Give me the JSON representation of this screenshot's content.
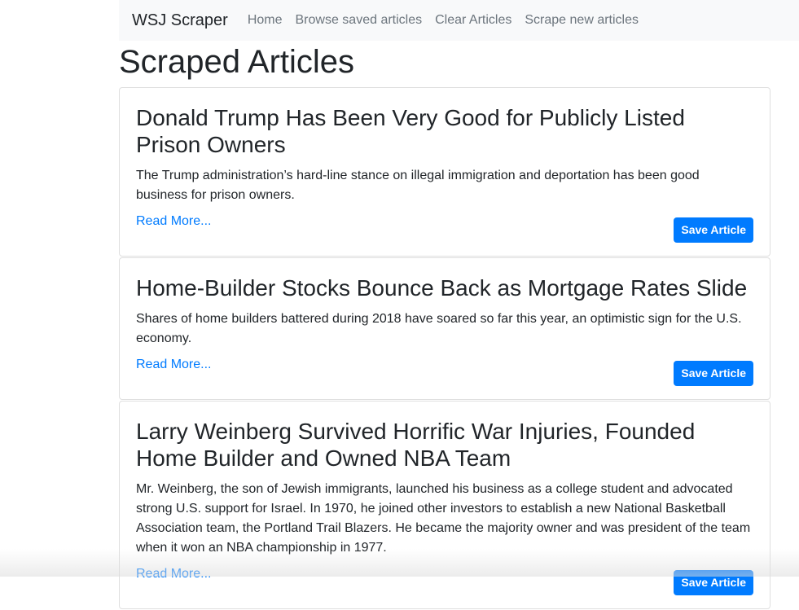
{
  "navbar": {
    "brand": "WSJ Scraper",
    "links": [
      {
        "label": "Home"
      },
      {
        "label": "Browse saved articles"
      },
      {
        "label": "Clear Articles"
      },
      {
        "label": "Scrape new articles"
      }
    ]
  },
  "page": {
    "title": "Scraped Articles"
  },
  "articles": [
    {
      "title": "Donald Trump Has Been Very Good for Publicly Listed Prison Owners",
      "summary": "The Trump administration’s hard-line stance on illegal immigration and deportation has been good business for prison owners.",
      "read_more": "Read More...",
      "save_label": "Save Article"
    },
    {
      "title": "Home-Builder Stocks Bounce Back as Mortgage Rates Slide",
      "summary": "Shares of home builders battered during 2018 have soared so far this year, an optimistic sign for the U.S. economy.",
      "read_more": "Read More...",
      "save_label": "Save Article"
    },
    {
      "title": "Larry Weinberg Survived Horrific War Injuries, Founded Home Builder and Owned NBA Team",
      "summary": "Mr. Weinberg, the son of Jewish immigrants, launched his business as a college student and advocated strong U.S. support for Israel. In 1970, he joined other investors to establish a new National Basketball Association team, the Portland Trail Blazers. He became the majority owner and was president of the team when it won an NBA championship in 1977.",
      "read_more": "Read More...",
      "save_label": "Save Article"
    }
  ],
  "colors": {
    "navbar_bg": "#f8f9fa",
    "link": "#007bff",
    "button_bg": "#007bff",
    "nav_text": "#6c757d"
  }
}
